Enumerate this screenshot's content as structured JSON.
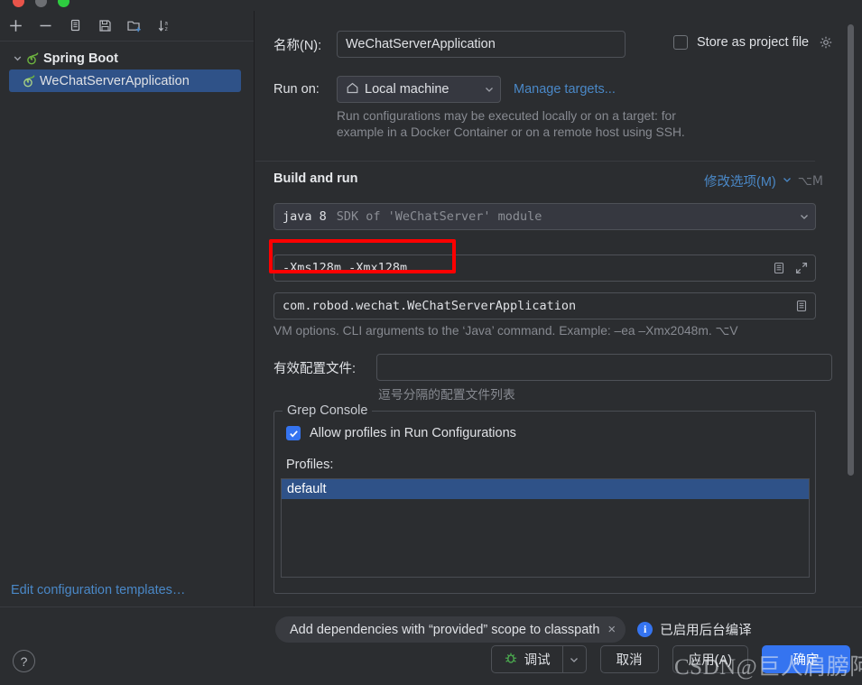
{
  "window": {
    "traffic_lights": [
      "close",
      "minimize",
      "maximize"
    ]
  },
  "sidebar": {
    "toolbar": [
      {
        "name": "add-icon",
        "glyph": "+"
      },
      {
        "name": "remove-icon",
        "glyph": "−"
      },
      {
        "name": "copy-icon",
        "glyph": "copy"
      },
      {
        "name": "save-icon",
        "glyph": "save"
      },
      {
        "name": "new-folder-icon",
        "glyph": "folder-plus"
      },
      {
        "name": "sort-alphabetically-icon",
        "glyph": "sort-az"
      }
    ],
    "tree": [
      {
        "label": "Spring Boot",
        "type": "group",
        "expanded": true
      },
      {
        "label": "WeChatServerApplication",
        "type": "child",
        "selected": true
      }
    ],
    "edit_templates_link": "Edit configuration templates…"
  },
  "form": {
    "name_label": "名称(N):",
    "name_value": "WeChatServerApplication",
    "store_as_project_file_label": "Store as project file",
    "store_as_project_file_checked": false,
    "run_on_label": "Run on:",
    "run_on_value": "Local machine",
    "manage_targets_link": "Manage targets...",
    "run_on_hint_line1": "Run configurations may be executed locally or on a target: for",
    "run_on_hint_line2": "example in a Docker Container or on a remote host using SSH.",
    "build_and_run_title": "Build and run",
    "modify_options_link": "修改选项(M)",
    "modify_options_shortcut": "⌥M",
    "sdk_primary": "java 8",
    "sdk_secondary": "SDK of 'WeChatServer' module",
    "vm_options_value": "-Xms128m -Xmx128m",
    "main_class_value": "com.robod.wechat.WeChatServerApplication",
    "vm_options_hint": "VM options. CLI arguments to the ‘Java’ command. Example: –ea –Xmx2048m. ⌥V",
    "active_profiles_label": "有效配置文件:",
    "active_profiles_value": "",
    "active_profiles_hint": "逗号分隔的配置文件列表"
  },
  "grep_console": {
    "legend": "Grep Console",
    "allow_profiles_label": "Allow profiles in Run Configurations",
    "allow_profiles_checked": true,
    "profiles_label": "Profiles:",
    "profiles": [
      {
        "label": "default",
        "selected": true
      }
    ]
  },
  "bottom": {
    "dependency_chip": "Add dependencies with “provided” scope to classpath",
    "dependency_chip_close": "×",
    "background_compile_status": "已启用后台编译",
    "info_icon_glyph": "i",
    "debug_button": "调试",
    "cancel_button": "取消",
    "apply_button": "应用(A)",
    "ok_button": "确定",
    "help_button": "?"
  },
  "watermark": {
    "text": "CSDN@巨人肩膀阿伟"
  },
  "annotation": {
    "color": "#ff0000",
    "target": "vm-options-field"
  },
  "colors": {
    "background": "#2b2d30",
    "accent_blue": "#3574f0",
    "link_blue": "#4a88c7",
    "selection_blue": "#2f5288",
    "annotation_red": "#ff0000",
    "spring_green": "#6db33f"
  }
}
